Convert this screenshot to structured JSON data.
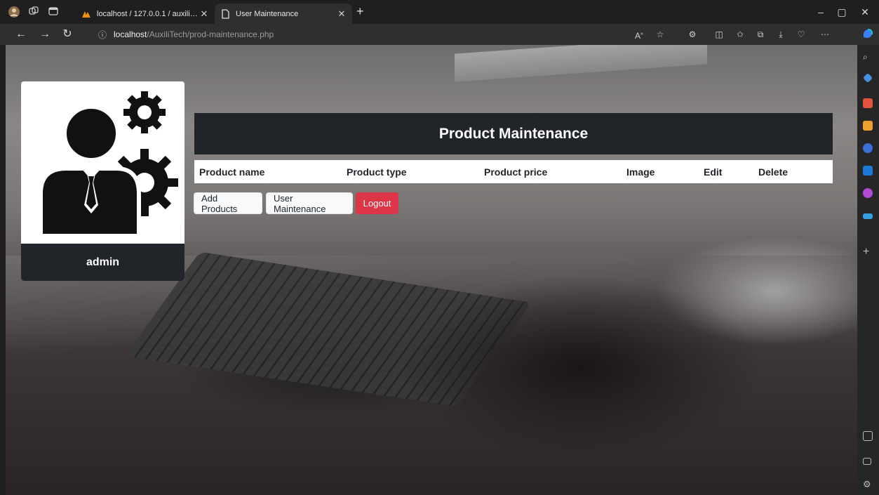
{
  "browser": {
    "tabs": [
      {
        "title": "localhost / 127.0.0.1 / auxilitech",
        "active": false
      },
      {
        "title": "User Maintenance",
        "active": true
      }
    ],
    "address": {
      "host": "localhost",
      "path": "/AuxiliTech/prod-maintenance.php"
    }
  },
  "profile": {
    "username": "admin"
  },
  "page": {
    "title": "Product Maintenance"
  },
  "table": {
    "columns": [
      "Product name",
      "Product type",
      "Product price",
      "Image",
      "Edit",
      "Delete"
    ]
  },
  "actions": {
    "add_products": "Add Products",
    "user_maintenance": "User Maintenance",
    "logout": "Logout"
  },
  "colors": {
    "dark": "#212529",
    "danger": "#dc3545",
    "light": "#f8f9fa"
  }
}
